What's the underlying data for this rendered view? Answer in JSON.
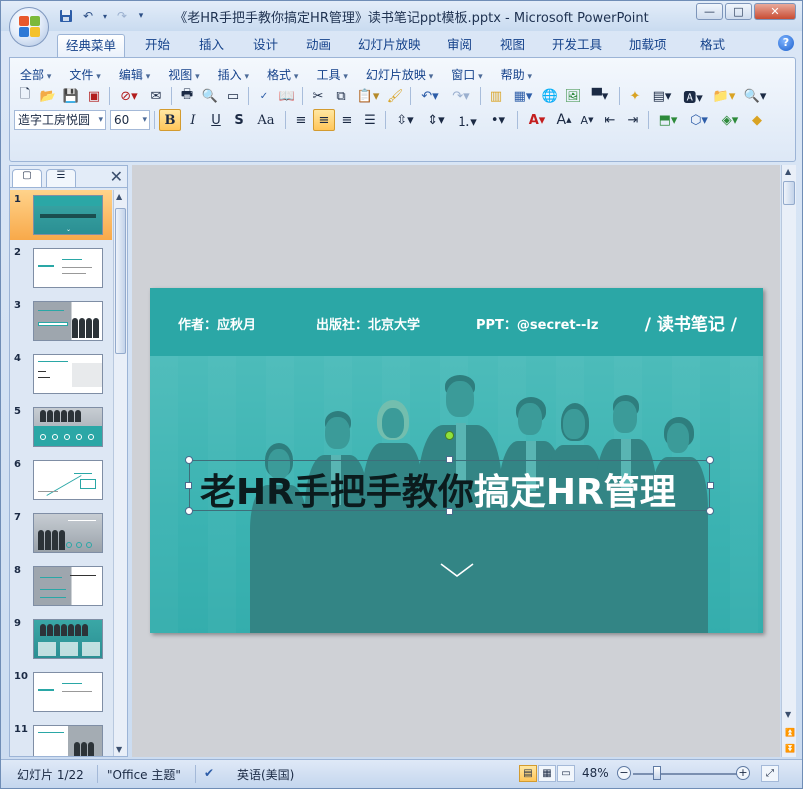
{
  "window": {
    "title": "《老HR手把手教你搞定HR管理》读书笔记ppt模板.pptx - Microsoft PowerPoint",
    "minimize": "—",
    "maximize": "□",
    "close": "✕"
  },
  "ribbon_tabs": [
    "经典菜单",
    "开始",
    "插入",
    "设计",
    "动画",
    "幻灯片放映",
    "审阅",
    "视图",
    "开发工具",
    "加载项",
    "格式"
  ],
  "help_label": "?",
  "classic_menu": [
    "全部",
    "文件",
    "编辑",
    "视图",
    "插入",
    "格式",
    "工具",
    "幻灯片放映",
    "窗口",
    "帮助"
  ],
  "format_bar": {
    "font_name": "造字工房悦圆",
    "font_size": "60",
    "bold": "B",
    "italic": "I",
    "underline": "U",
    "shadow": "S",
    "change_case": "Aa"
  },
  "slides_pane": {
    "count_visible": 11,
    "numbers": [
      "1",
      "2",
      "3",
      "4",
      "5",
      "6",
      "7",
      "8",
      "9",
      "10",
      "11"
    ],
    "selected": 1
  },
  "slide": {
    "author": "作者：应秋月",
    "publisher": "出版社：北京大学",
    "ppt_credit": "PPT：@secret--lz",
    "tag": "/ 读书笔记 /",
    "title_dark": "老HR手把手教你",
    "title_light": "搞定HR管理"
  },
  "statusbar": {
    "slide_position": "幻灯片 1/22",
    "theme": "\"Office 主题\"",
    "language": "英语(美国)",
    "zoom": "48%",
    "zoom_level": 0.48
  },
  "colors": {
    "slide_teal": "#2ba7a6",
    "selected_thumb": "#f8a94a",
    "ribbon_text": "#15428b"
  }
}
